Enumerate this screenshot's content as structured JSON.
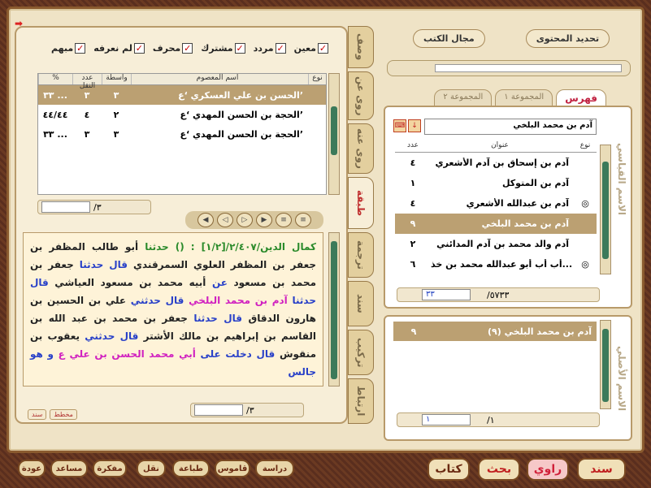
{
  "filters": [
    {
      "label": "معين"
    },
    {
      "label": "مردد"
    },
    {
      "label": "مشترك"
    },
    {
      "label": "محرف"
    },
    {
      "label": "لم نعرفه"
    },
    {
      "label": "مبهم"
    }
  ],
  "left_table": {
    "headers": {
      "type": "نوع",
      "name": "اسم المعصوم",
      "wasita": "واسطة",
      "count": "عدد النقل",
      "pct": "%"
    },
    "rows": [
      {
        "name": "الحسن بن علي العسكري ‘ع’",
        "wasita": "٣",
        "count": "٣",
        "pct": "٣٣ ..."
      },
      {
        "name": "الحجة بن الحسن المهدي ‘ع’",
        "wasita": "٢",
        "count": "٤",
        "pct": "٤٤/٤٤"
      },
      {
        "name": "الحجة بن الحسن المهدي ‘ع’",
        "wasita": "٣",
        "count": "٣",
        "pct": "٣٣ ..."
      }
    ],
    "pager": "/٣"
  },
  "hadith": {
    "seg1": "كمال الدين/٢/٤٠٧/[١/٢] : () حدثنا",
    "seg2": " أبو طالب المظفر بن جعفر بن المظفر العلوي السمرقندي ",
    "seg3": "قال حدثنا",
    "seg4": " جعفر بن محمد بن مسعود ",
    "seg5": "عن",
    "seg6": " أبيه محمد بن مسعود العياشي ",
    "seg7": "قال حدثنا",
    "seg8": " آدم بن محمد البلخي ",
    "seg9": "قال حدثني",
    "seg10": " علي بن الحسين بن هارون الدقاق ",
    "seg11": "قال حدثنا",
    "seg12": " جعفر بن محمد بن عبد الله بن القاسم بن إبراهيم بن مالك الأشتر ",
    "seg13": "قال حدثني",
    "seg14": " يعقوب بن منقوش ",
    "seg15": "قال دخلت على",
    "seg16": " أبي محمد الحسن بن علي ع ",
    "seg17": "و هو جالس"
  },
  "hadith_pager": "/٣",
  "small_buttons": {
    "manuscript": "مخطط",
    "sanad": "سند"
  },
  "side_tabs": {
    "wasf": "وصف",
    "rawa_an": "روى عن",
    "rawa_anhu": "روى عنه",
    "tabaqa": "طبقة",
    "tarjama": "ترجمة",
    "sanad": "سند",
    "tarkib": "تركيب",
    "irtibat": "ارتباط"
  },
  "top_buttons": {
    "content": "تحديد المحتوى",
    "books": "مجال الكتب"
  },
  "right_tabs": {
    "fihris": "فهرس",
    "g1": "المجموعة ١",
    "g2": "المجموعة ٢"
  },
  "search_value": "آدم بن محمد البلخي",
  "right_table": {
    "headers": {
      "type": "نوع",
      "title": "عنوان",
      "count": "عدد"
    },
    "rows": [
      {
        "title": "آدم بن إسحاق بن آدم الأشعري",
        "count": "٤",
        "icon": ""
      },
      {
        "title": "آدم بن المتوكل",
        "count": "١",
        "icon": ""
      },
      {
        "title": "آدم بن عبدالله الأشعري",
        "count": "٤",
        "icon": "◎"
      },
      {
        "title": "آدم بن محمد البلخي",
        "count": "٩",
        "icon": ""
      },
      {
        "title": "آدم والد محمد بن آدم المدائني",
        "count": "٢",
        "icon": ""
      },
      {
        "title": "أب أب أبو عبدالله محمد بن خذ...",
        "count": "٦",
        "icon": "◎"
      }
    ],
    "pager_total": "/٥٧٣٣",
    "pager_value": "٣٣"
  },
  "vertical_labels": {
    "qiyasi": "الاسم القياسي",
    "asli": "الاسم الأصلي"
  },
  "lower_list": {
    "row": "آدم بن محمد البلخي (٩)",
    "count": "٩",
    "pager_total": "/١",
    "pager_value": "١"
  },
  "bottom": {
    "sanad": "سند",
    "rawi": "راوي",
    "bahth": "بحث",
    "kitab": "كتاب",
    "dirasa": "دراسة",
    "qamus": "قاموس",
    "tibaa": "طباعة",
    "naql": "نقل",
    "mafkara": "مفكرة",
    "musaid": "مساعد",
    "awda": "عودة"
  }
}
